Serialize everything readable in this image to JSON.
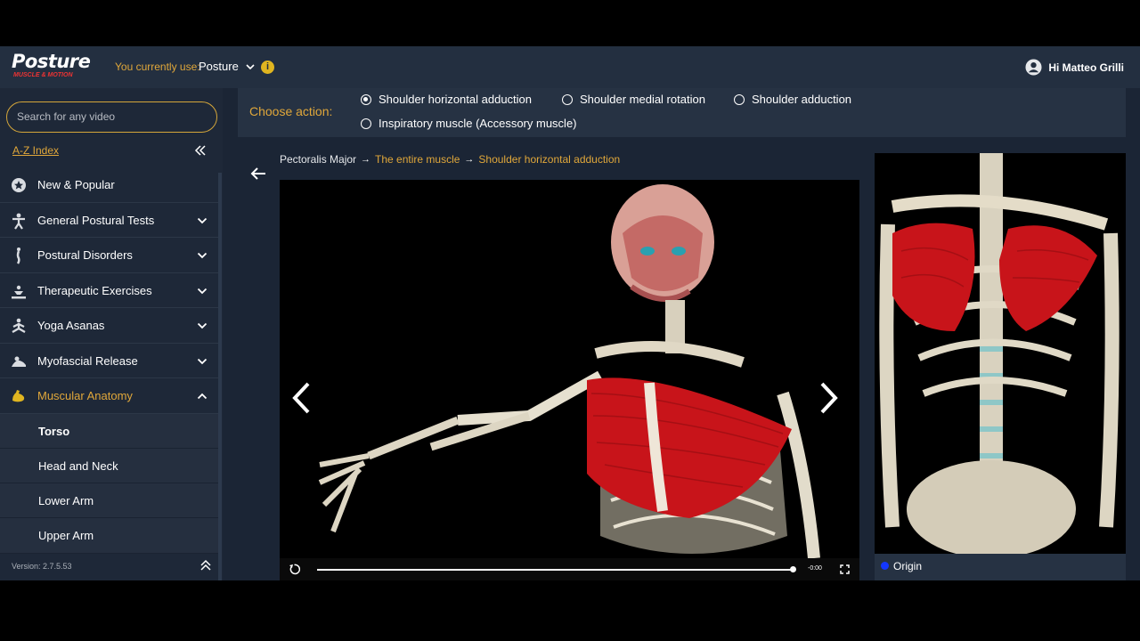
{
  "app": {
    "logo_text": "Posture",
    "logo_sub": "MUSCLE & MOTION",
    "current_label": "You currently use:",
    "current_value": "Posture",
    "user_greeting": "Hi Matteo Grilli"
  },
  "sidebar": {
    "search_placeholder": "Search for any video",
    "az_index": "A-Z Index",
    "items": [
      {
        "label": "New & Popular",
        "icon": "star-icon"
      },
      {
        "label": "General Postural Tests",
        "icon": "figure-test-icon"
      },
      {
        "label": "Postural Disorders",
        "icon": "spine-icon"
      },
      {
        "label": "Therapeutic Exercises",
        "icon": "exercise-icon"
      },
      {
        "label": "Yoga Asanas",
        "icon": "yoga-icon"
      },
      {
        "label": "Myofascial Release",
        "icon": "release-icon"
      },
      {
        "label": "Muscular Anatomy",
        "icon": "bicep-icon"
      }
    ],
    "subitems": [
      "Torso",
      "Head and Neck",
      "Lower Arm",
      "Upper Arm"
    ],
    "version": "Version: 2.7.5.53"
  },
  "action": {
    "label": "Choose action:",
    "options": [
      "Shoulder horizontal adduction",
      "Shoulder medial rotation",
      "Shoulder adduction",
      "Inspiratory muscle (Accessory muscle)"
    ],
    "selected": 0
  },
  "breadcrumb": {
    "muscle": "Pectoralis Major",
    "part": "The entire muscle",
    "action": "Shoulder horizontal adduction"
  },
  "video": {
    "time": "-0:00",
    "progress": 1.0
  },
  "side_panel": {
    "origin_label": "Origin",
    "origin_color": "#1437ff"
  },
  "colors": {
    "accent": "#e0a73a",
    "background": "#1b2535",
    "muscle_red": "#c8141a"
  }
}
